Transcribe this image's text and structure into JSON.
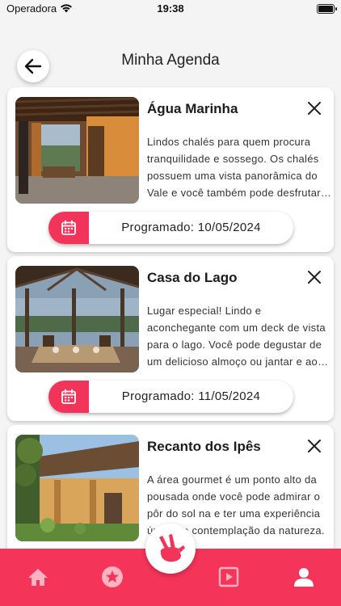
{
  "status_bar": {
    "carrier": "Operadora",
    "time": "19:38"
  },
  "header": {
    "title": "Minha Agenda"
  },
  "colors": {
    "accent": "#f53459",
    "badge": "#f2335a"
  },
  "cards": [
    {
      "title": "Água Marinha",
      "description": "Lindos chalés para quem procura tranquilidade e sossego. Os chalés possuem uma vista panorâmica do Vale e você também pode desfrutar desta vista durante o seu café da manhã.",
      "schedule": "Programado: 10/05/2024"
    },
    {
      "title": "Casa do Lago",
      "description": "Lugar especial! Lindo e aconchegante com um deck de vista para o lago. Você pode degustar de um delicioso almoço ou jantar e ao mesmo tempo desfrutar de uma vista e um clima maravilhoso.",
      "schedule": "Programado: 11/05/2024"
    },
    {
      "title": "Recanto dos Ipês",
      "description": "A área gourmet é um ponto alto da pousada onde você pode admirar o pôr do sol na e ter uma experiência única de contemplação da natureza.",
      "schedule": ""
    }
  ],
  "bottom_nav": {
    "items": [
      "home-icon",
      "star-icon",
      "center-hand-logo",
      "video-icon",
      "profile-icon"
    ]
  }
}
